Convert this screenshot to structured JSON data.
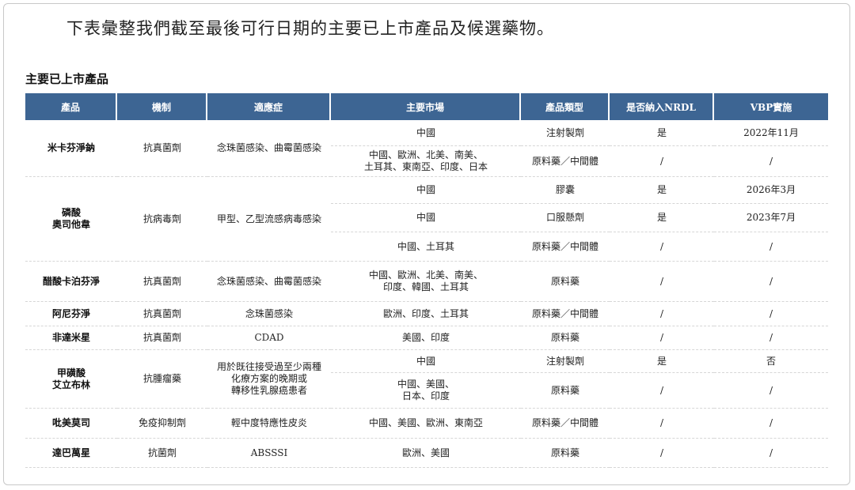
{
  "intro": "下表彙整我們截至最後可行日期的主要已上市產品及候選藥物。",
  "section_title": "主要已上市產品",
  "table": {
    "headers": [
      "產品",
      "機制",
      "適應症",
      "主要市場",
      "產品類型",
      "是否納入NRDL",
      "VBP實施"
    ],
    "products": [
      {
        "name": "米卡芬淨鈉",
        "mechanism": "抗真菌劑",
        "indication": "念珠菌感染、曲霉菌感染",
        "rows": [
          {
            "market": "中國",
            "type": "注射製劑",
            "nrdl": "是",
            "vbp": "2022年11月"
          },
          {
            "market": "中國、歐洲、北美、南美、\n土耳其、東南亞、印度、日本",
            "type": "原料藥／中間體",
            "nrdl": "/",
            "vbp": "/"
          }
        ]
      },
      {
        "name": "磷酸\n奧司他韋",
        "mechanism": "抗病毒劑",
        "indication": "甲型、乙型流感病毒感染",
        "rows": [
          {
            "market": "中國",
            "type": "膠囊",
            "nrdl": "是",
            "vbp": "2026年3月"
          },
          {
            "market": "中國",
            "type": "口服懸劑",
            "nrdl": "是",
            "vbp": "2023年7月"
          },
          {
            "market": "中國、土耳其",
            "type": "原料藥／中間體",
            "nrdl": "/",
            "vbp": "/"
          }
        ]
      },
      {
        "name": "醋酸卡泊芬淨",
        "mechanism": "抗真菌劑",
        "indication": "念珠菌感染、曲霉菌感染",
        "rows": [
          {
            "market": "中國、歐洲、北美、南美、\n印度、韓國、土耳其",
            "type": "原料藥",
            "nrdl": "/",
            "vbp": "/"
          }
        ]
      },
      {
        "name": "阿尼芬淨",
        "mechanism": "抗真菌劑",
        "indication": "念珠菌感染",
        "rows": [
          {
            "market": "歐洲、印度、土耳其",
            "type": "原料藥／中間體",
            "nrdl": "/",
            "vbp": "/"
          }
        ]
      },
      {
        "name": "非達米星",
        "mechanism": "抗真菌劑",
        "indication": "CDAD",
        "rows": [
          {
            "market": "美國、印度",
            "type": "原料藥",
            "nrdl": "/",
            "vbp": "/"
          }
        ]
      },
      {
        "name": "甲磺酸\n艾立布林",
        "mechanism": "抗腫瘤藥",
        "indication": "用於既往接受過至少兩種\n化療方案的晚期或\n轉移性乳腺癌患者",
        "rows": [
          {
            "market": "中國",
            "type": "注射製劑",
            "nrdl": "是",
            "vbp": "否"
          },
          {
            "market": "中國、美國、\n日本、印度",
            "type": "原料藥",
            "nrdl": "/",
            "vbp": "/"
          }
        ]
      },
      {
        "name": "吡美莫司",
        "mechanism": "免疫抑制劑",
        "indication": "輕中度特應性皮炎",
        "rows": [
          {
            "market": "中國、美國、歐洲、東南亞",
            "type": "原料藥／中間體",
            "nrdl": "/",
            "vbp": "/"
          }
        ]
      },
      {
        "name": "達巴萬星",
        "mechanism": "抗菌劑",
        "indication": "ABSSSI",
        "rows": [
          {
            "market": "歐洲、美國",
            "type": "原料藥",
            "nrdl": "/",
            "vbp": "/"
          }
        ]
      }
    ]
  }
}
